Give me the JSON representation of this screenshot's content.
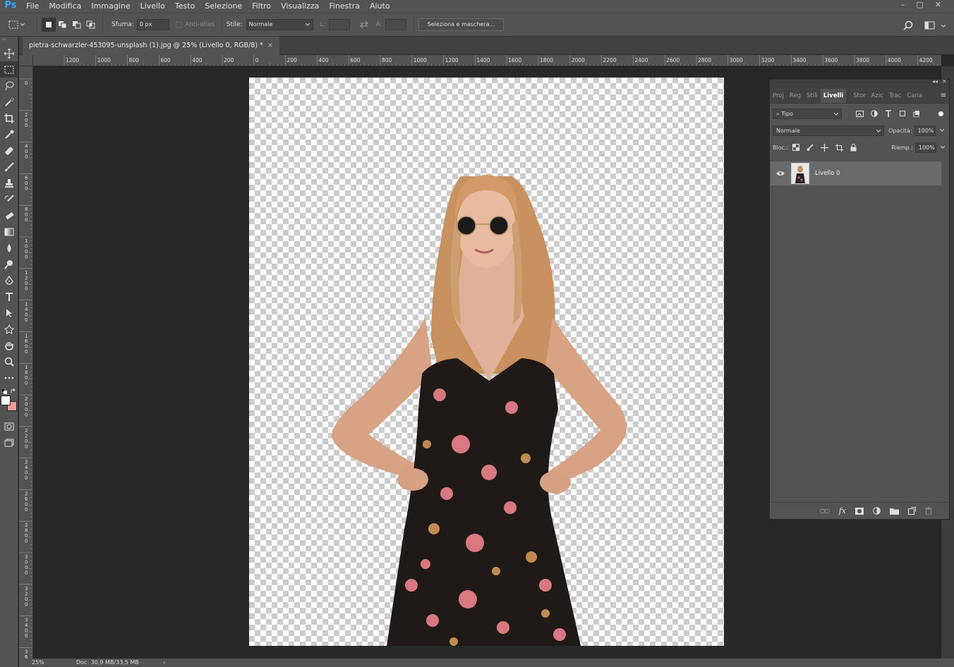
{
  "app": {
    "logo": "Ps"
  },
  "menu": [
    "File",
    "Modifica",
    "Immagine",
    "Livello",
    "Testo",
    "Selezione",
    "Filtro",
    "Visualizza",
    "Finestra",
    "Aiuto"
  ],
  "window_controls": [
    "–",
    "▢",
    "✕"
  ],
  "options": {
    "feather_label": "Sfuma:",
    "feather_value": "0 px",
    "antialias_label": "Anti-alias",
    "style_label": "Stile:",
    "style_value": "Normale",
    "width_label": "L:",
    "height_label": "A:",
    "select_mask_label": "Seleziona e maschera..."
  },
  "document": {
    "tab_title": "pietra-schwarzler-453095-unsplash (1).jpg @ 25% (Livello 0, RGB/8) *",
    "close": "×"
  },
  "ruler": {
    "top_labels": [
      "1200",
      "1000",
      "800",
      "600",
      "400",
      "200",
      "0",
      "200",
      "400",
      "600",
      "800",
      "1000",
      "1200",
      "1400",
      "1600",
      "1800",
      "2000",
      "2200",
      "2400",
      "2600",
      "2800",
      "3000",
      "3200",
      "3400",
      "3600",
      "3800",
      "4000",
      "4200"
    ],
    "left_labels": [
      "0",
      "2 0 0",
      "4 0 0",
      "6 0 0",
      "8 0 0",
      "1 0 0 0",
      "1 2 0 0",
      "1 4 0 0",
      "1 6 0 0",
      "1 8 0 0",
      "2 0 0 0",
      "2 2 0 0",
      "2 4 0 0",
      "2 6 0 0",
      "2 8 0 0",
      "3 0 0 0",
      "3 2 0 0",
      "3 4 0 0",
      "3 6 0 0"
    ]
  },
  "status": {
    "zoom": "25%",
    "doc_info": "Doc: 30,9 MB/33,5 MB",
    "arrow": "›"
  },
  "layers_panel": {
    "tabs": [
      "Proj",
      "Reg",
      "Stili",
      "Livelli",
      "Stor",
      "Azic",
      "Trac",
      "Cana"
    ],
    "active_tab": "Livelli",
    "filter_value": "Tipo",
    "blend_mode": "Normale",
    "opacity_label": "Opacità:",
    "opacity_value": "100%",
    "lock_label": "Bloc.:",
    "fill_label": "Riemp.:",
    "fill_value": "100%",
    "layer_name": "Livello 0"
  },
  "colors": {
    "foreground": "#ffffff",
    "background": "#f09a9a",
    "accent": "#31a8ff"
  }
}
